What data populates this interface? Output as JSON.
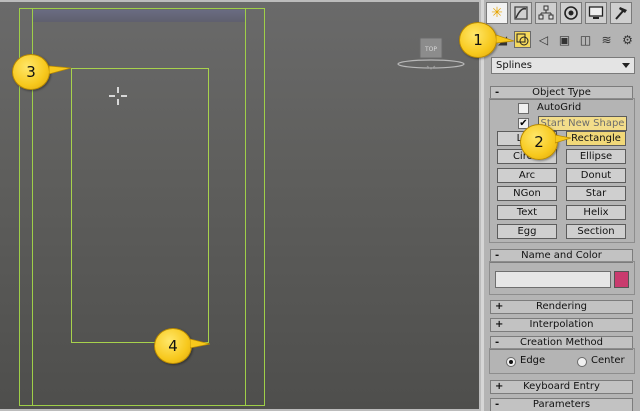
{
  "viewport": {
    "viewcube_label": "TOP"
  },
  "callouts": [
    "1",
    "2",
    "3",
    "4"
  ],
  "panel": {
    "tabs": [
      "create-icon",
      "modify-icon",
      "hierarchy-icon",
      "motion-icon",
      "display-icon",
      "utilities-icon"
    ],
    "subtabs": [
      "geometry-icon",
      "shapes-icon",
      "lights-icon",
      "cameras-icon",
      "helpers-icon",
      "spacewarps-icon",
      "systems-icon"
    ],
    "category": "Splines",
    "object_type": {
      "title": "Object Type",
      "autogrid_label": "AutoGrid",
      "start_new_shape_label": "Start New Shape",
      "start_new_shape_checked": true,
      "buttons": [
        "Line",
        "Rectangle",
        "Circle",
        "Ellipse",
        "Arc",
        "Donut",
        "NGon",
        "Star",
        "Text",
        "Helix",
        "Egg",
        "Section"
      ],
      "active_button": "Rectangle"
    },
    "name_and_color": {
      "title": "Name and Color",
      "name_value": "",
      "color": "#c93b6e"
    },
    "rendering_title": "Rendering",
    "interpolation_title": "Interpolation",
    "creation_method": {
      "title": "Creation Method",
      "options": [
        "Edge",
        "Center"
      ],
      "selected": "Edge"
    },
    "keyboard_entry_title": "Keyboard Entry",
    "parameters_title": "Parameters"
  }
}
